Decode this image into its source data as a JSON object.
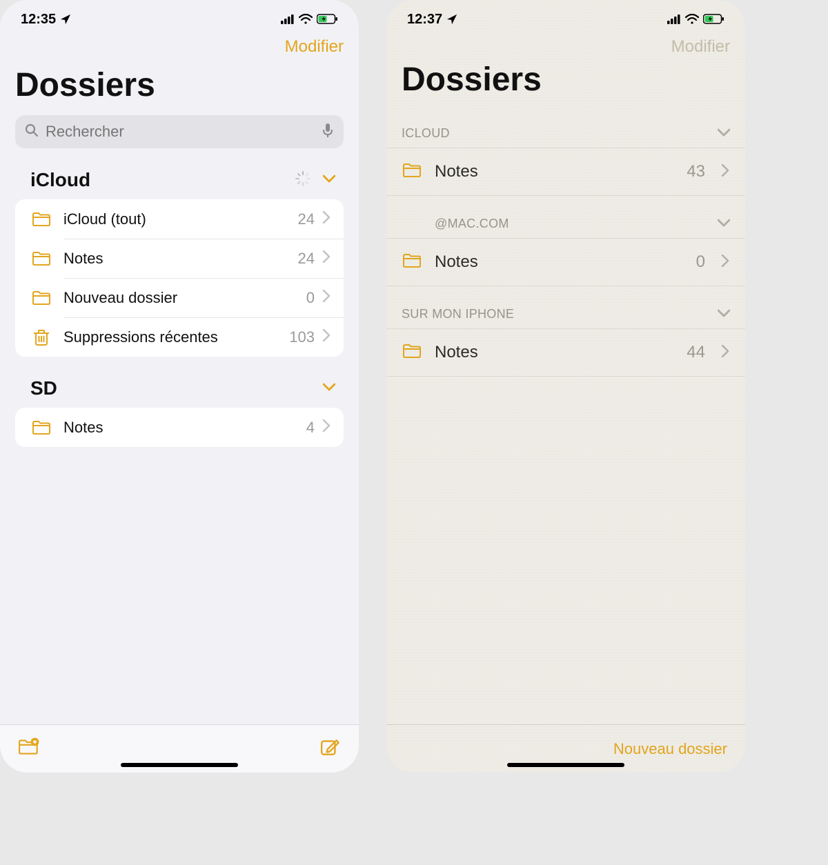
{
  "left": {
    "status": {
      "time": "12:35"
    },
    "edit": "Modifier",
    "title": "Dossiers",
    "search": {
      "placeholder": "Rechercher"
    },
    "sections": [
      {
        "name": "iCloud",
        "syncing": true,
        "rows": [
          {
            "icon": "folder",
            "name": "iCloud (tout)",
            "count": "24"
          },
          {
            "icon": "folder",
            "name": "Notes",
            "count": "24"
          },
          {
            "icon": "folder",
            "name": "Nouveau dossier",
            "count": "0"
          },
          {
            "icon": "trash",
            "name": "Suppressions récentes",
            "count": "103"
          }
        ]
      },
      {
        "name": "SD",
        "rows": [
          {
            "icon": "folder",
            "name": "Notes",
            "count": "4"
          }
        ]
      }
    ]
  },
  "right": {
    "status": {
      "time": "12:37"
    },
    "edit": "Modifier",
    "title": "Dossiers",
    "sections": [
      {
        "name": "ICLOUD",
        "rows": [
          {
            "name": "Notes",
            "count": "43"
          }
        ]
      },
      {
        "name": "@MAC.COM",
        "indent": true,
        "rows": [
          {
            "name": "Notes",
            "count": "0"
          }
        ]
      },
      {
        "name": "SUR MON IPHONE",
        "rows": [
          {
            "name": "Notes",
            "count": "44"
          }
        ]
      }
    ],
    "new_folder": "Nouveau dossier"
  }
}
